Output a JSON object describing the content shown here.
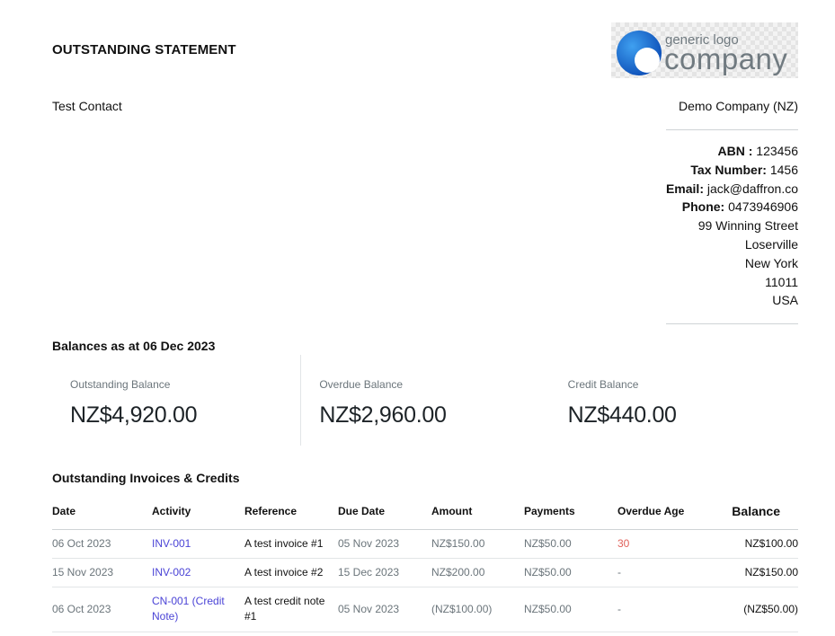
{
  "title": "OUTSTANDING STATEMENT",
  "logo": {
    "small_text": "generic logo",
    "big_text": "company"
  },
  "contact_name": "Test Contact",
  "company": {
    "name": "Demo Company (NZ)",
    "abn_label": "ABN :",
    "abn": "123456",
    "tax_label": "Tax Number:",
    "tax": "1456",
    "email_label": "Email:",
    "email": "jack@daffron.co",
    "phone_label": "Phone:",
    "phone": "0473946906",
    "address": [
      "99 Winning Street",
      "Loserville",
      "New York",
      "11011",
      "USA"
    ]
  },
  "balances_heading": "Balances as at 06 Dec 2023",
  "balances": [
    {
      "label": "Outstanding Balance",
      "value": "NZ$4,920.00"
    },
    {
      "label": "Overdue Balance",
      "value": "NZ$2,960.00"
    },
    {
      "label": "Credit Balance",
      "value": "NZ$440.00"
    }
  ],
  "invoices_heading": "Outstanding Invoices & Credits",
  "table": {
    "headers": [
      "Date",
      "Activity",
      "Reference",
      "Due Date",
      "Amount",
      "Payments",
      "Overdue Age",
      "Balance"
    ],
    "rows": [
      [
        "06 Oct 2023",
        "INV-001",
        "A test invoice #1",
        "05 Nov 2023",
        "NZ$150.00",
        "NZ$50.00",
        "30",
        "NZ$100.00"
      ],
      [
        "15 Nov 2023",
        "INV-002",
        "A test invoice #2",
        "15 Dec 2023",
        "NZ$200.00",
        "NZ$50.00",
        "-",
        "NZ$150.00"
      ],
      [
        "06 Oct 2023",
        "CN-001 (Credit Note)",
        "A test credit note #1",
        "05 Nov 2023",
        "(NZ$100.00)",
        "NZ$50.00",
        "-",
        "(NZ$50.00)"
      ]
    ]
  },
  "colors": {
    "link": "#4b44d6",
    "overdue": "#e0615b",
    "muted": "#6b757b",
    "logo_blue": "#1a6fd6"
  }
}
